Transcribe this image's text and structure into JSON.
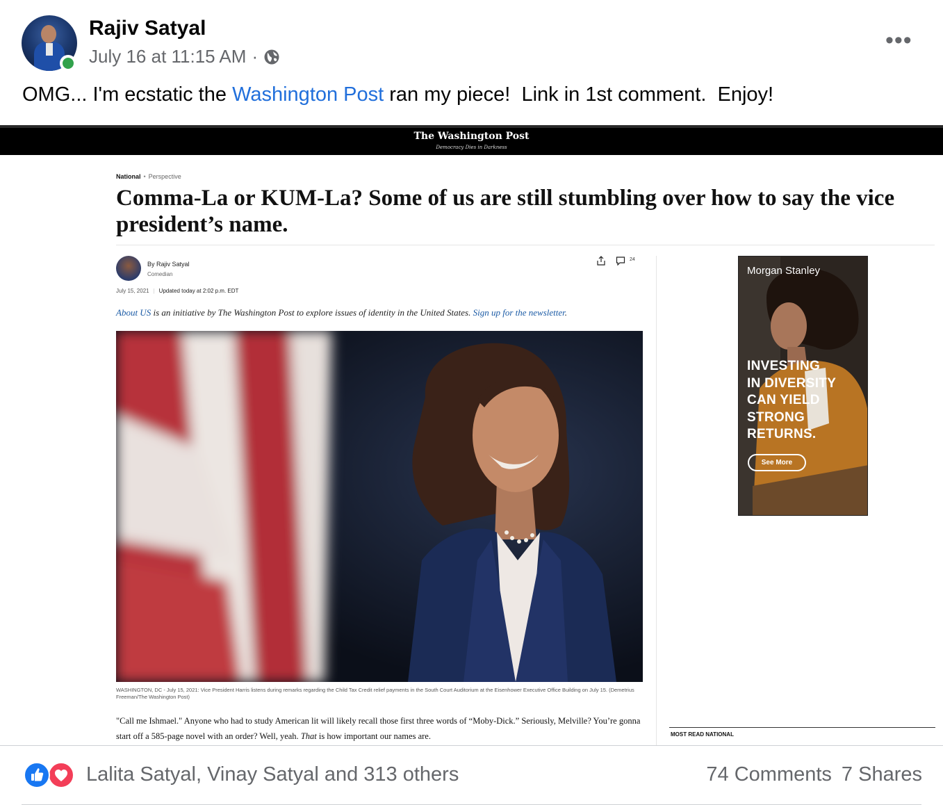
{
  "post": {
    "author": "Rajiv Satyal",
    "timestamp": "July 16 at 11:15 AM",
    "separator": "·",
    "privacy_icon": "globe-icon",
    "more_icon": "more-options-icon",
    "text_before_link": "OMG... I'm ecstatic the ",
    "text_link": "Washington Post",
    "text_after_link": " ran my piece!  Link in 1st comment.  Enjoy!"
  },
  "article": {
    "masthead": "The Washington Post",
    "tagline": "Democracy Dies in Darkness",
    "section": "National",
    "section_dot": "•",
    "subsection": "Perspective",
    "headline": "Comma-La or KUM-La? Some of us are still stumbling over how to say the vice president’s name.",
    "byline": "By Rajiv Satyal",
    "byline_role": "Comedian",
    "date": "July 15, 2021",
    "updated": "Updated today at 2:02 p.m. EDT",
    "comment_count": "24",
    "about_link": "About US",
    "about_text": " is an initiative by The Washington Post to explore issues of identity in the United States. ",
    "newsletter_link": "Sign up for the newsletter",
    "newsletter_end": ".",
    "caption": "WASHINGTON, DC - July 15, 2021: Vice President Harris listens during remarks regarding the Child Tax Credit relief payments in the South Court Auditorium at the Eisenhower Executive Office Building on July 15. (Demetrius Freeman/The Washington Post)",
    "body_part1": "\"Call me Ishmael.\" Anyone who had to study American lit will likely recall those first three words of “Moby-Dick.” Seriously, Melville? You’re gonna start off a 585-page novel with an order? Well, yeah. ",
    "body_italic": "That",
    "body_part2": " is how important our names are.",
    "most_read": "MOST READ NATIONAL"
  },
  "ad": {
    "brand": "Morgan Stanley",
    "line1": "INVESTING",
    "line2": "IN DIVERSITY",
    "line3": "CAN YIELD",
    "line4": "STRONG",
    "line5": "RETURNS.",
    "button": "See More"
  },
  "footer": {
    "reactions": "Lalita Satyal, Vinay Satyal and 313 others",
    "comments": "74 Comments",
    "shares": "7 Shares"
  },
  "colors": {
    "link": "#216fdb",
    "like": "#1877f2",
    "love": "#f33e58",
    "online": "#31a24c",
    "secondary_text": "#65676b"
  }
}
